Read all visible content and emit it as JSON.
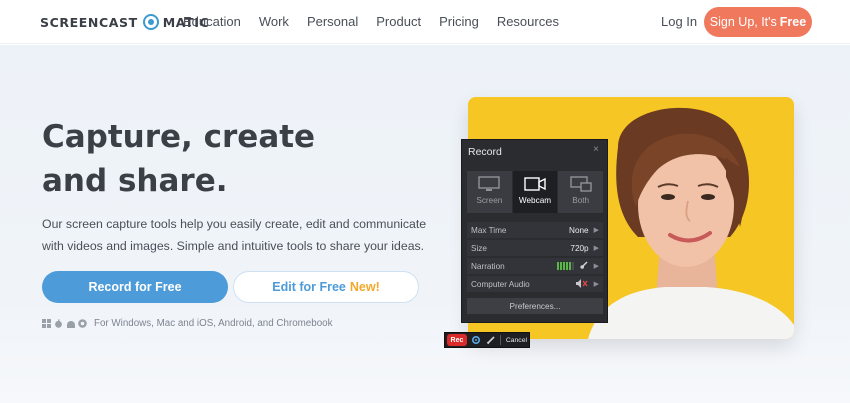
{
  "brand": {
    "left": "SCREENCAST",
    "right": "MATIC"
  },
  "nav": {
    "links": [
      "Education",
      "Work",
      "Personal",
      "Product",
      "Pricing",
      "Resources"
    ],
    "login": "Log In",
    "signup_prefix": "Sign Up, It's",
    "signup_emph": "Free"
  },
  "hero": {
    "headline": "Capture, create and share.",
    "subtext": "Our screen capture tools help you easily create, edit and communicate with videos and images. Simple and intuitive tools to share your ideas.",
    "record_button": "Record for Free",
    "edit_button": "Edit for Free",
    "edit_new": "New!",
    "platforms": "For Windows, Mac and iOS, Android, and Chromebook"
  },
  "recorder": {
    "title": "Record",
    "close": "×",
    "modes": [
      "Screen",
      "Webcam",
      "Both"
    ],
    "active_mode": "Webcam",
    "rows": {
      "max_time_label": "Max Time",
      "max_time_value": "None",
      "size_label": "Size",
      "size_value": "720p",
      "narration_label": "Narration",
      "computer_audio_label": "Computer Audio"
    },
    "preferences": "Preferences...",
    "rec_label": "Rec",
    "cancel_label": "Cancel"
  },
  "colors": {
    "accent_blue": "#4d9bd9",
    "signup_orange": "#f0785c",
    "new_badge": "#f2a92b",
    "photo_bg": "#f6c624",
    "panel_bg": "#2a2c30",
    "rec_red": "#d92b2b"
  },
  "icons": [
    "windows-icon",
    "apple-icon",
    "android-icon",
    "chrome-icon",
    "close-icon",
    "screen-icon",
    "webcam-icon",
    "both-icon",
    "chevron-right-icon",
    "microphone-icon",
    "speaker-muted-icon",
    "gear-icon",
    "pencil-icon"
  ]
}
